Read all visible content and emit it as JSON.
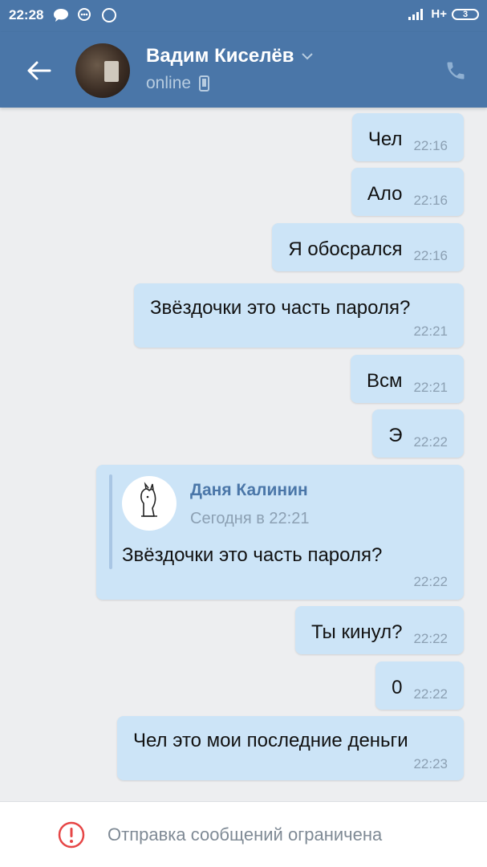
{
  "statusbar": {
    "time": "22:28",
    "network": "H+",
    "battery": "3"
  },
  "header": {
    "name": "Вадим Киселёв",
    "status": "online"
  },
  "messages": [
    {
      "text": "Чел",
      "time": "22:16"
    },
    {
      "text": "Ало",
      "time": "22:16"
    },
    {
      "text": "Я обосрался",
      "time": "22:16"
    },
    {
      "text": "Звёздочки это часть пароля?",
      "time": "22:21"
    },
    {
      "text": "Всм",
      "time": "22:21"
    },
    {
      "text": "Э",
      "time": "22:22"
    },
    {
      "forwarded": {
        "author": "Даня Калинин",
        "date": "Сегодня в 22:21",
        "text": "Звёздочки это часть пароля?"
      },
      "time": "22:22"
    },
    {
      "text": "Ты кинул?",
      "time": "22:22"
    },
    {
      "text": "0",
      "time": "22:22"
    },
    {
      "text": "Чел это мои последние деньги",
      "time": "22:23"
    }
  ],
  "footer": {
    "notice": "Отправка сообщений ограничена"
  },
  "colors": {
    "header": "#4a76a8",
    "bubble": "#cce4f7",
    "background": "#edeef0",
    "warning": "#e64646"
  }
}
